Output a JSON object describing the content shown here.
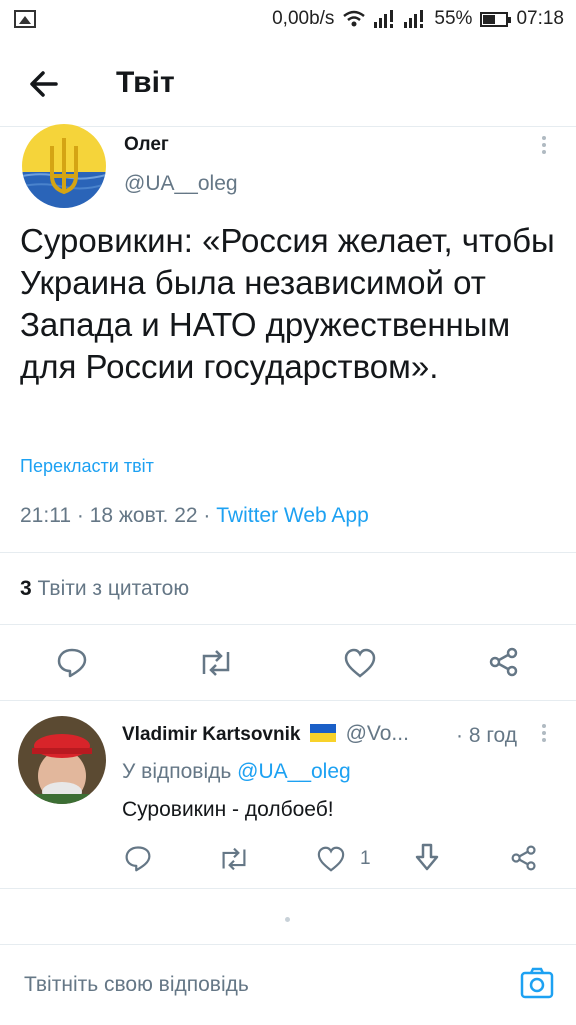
{
  "status_bar": {
    "speed": "0,00b/s",
    "battery": "55%",
    "time": "07:18",
    "battery_level": 0.55
  },
  "header": {
    "title": "Твіт"
  },
  "tweet": {
    "author_name": "Олег",
    "author_handle": "@UA__oleg",
    "text": "Суровикин: «Россия желает, чтобы Украина была независимой от Запада и НАТО дружественным для России государством».",
    "translate_label": "Перекласти твіт",
    "timestamp": "21:11 · 18 жовт. 22 · ",
    "source": "Twitter Web App",
    "quote_count": "3",
    "quote_label": " Твіти з цитатою"
  },
  "reply": {
    "author_name": "Vladimir Kartsovnik",
    "author_handle": "@Vo...",
    "time": "· 8 год",
    "reply_to_label": "У відповідь ",
    "reply_to_handle": "@UA__oleg",
    "text": "Суровикин - долбоеб!",
    "like_count": "1"
  },
  "compose": {
    "placeholder": "Твітніть свою відповідь"
  },
  "colors": {
    "accent": "#1da1f2",
    "text": "#14171a",
    "secondary": "#657786",
    "divider": "#e6ecf0"
  }
}
